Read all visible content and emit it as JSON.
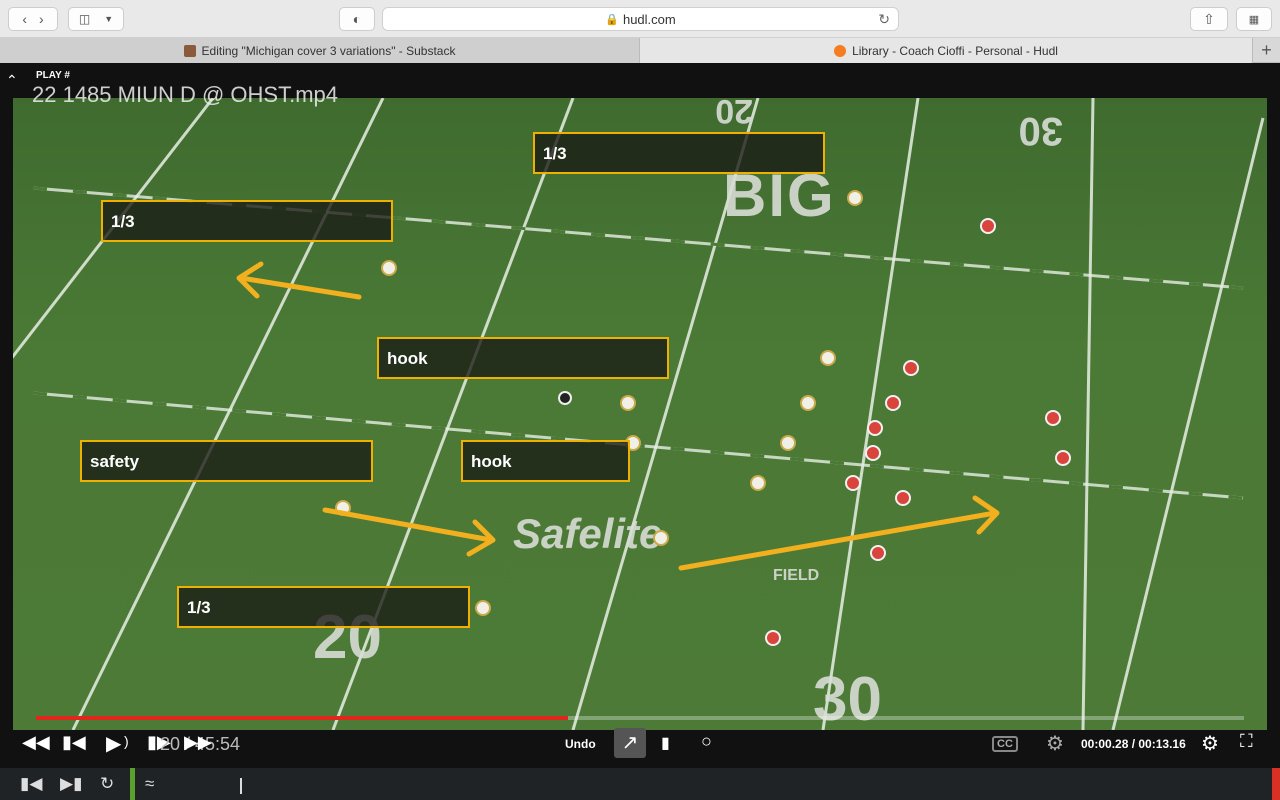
{
  "browser": {
    "url": "hudl.com",
    "tabs": [
      {
        "title": "Editing \"Michigan cover 3 variations\" - Substack"
      },
      {
        "title": "Library - Coach Cioffi - Personal - Hudl"
      }
    ],
    "new_tab_label": "+"
  },
  "player": {
    "play_label": "PLAY #",
    "filename": "22 1485 MIUN D @ OHST.mp4",
    "annotations": [
      {
        "text": "1/3"
      },
      {
        "text": "1/3"
      },
      {
        "text": "hook"
      },
      {
        "text": "safety"
      },
      {
        "text": "hook"
      },
      {
        "text": "1/3"
      }
    ],
    "field_numbers": [
      "20",
      "30",
      "30",
      "20"
    ],
    "field_logo": "BIG",
    "field_sponsor": "Safelite",
    "field_sponsor_sub": "FIELD",
    "progress": 0.44,
    "clip_time": "20 / 45:54",
    "undo_label": "Undo",
    "video_time": "00:00.28 / 00:13.16",
    "cc_label": "CC"
  },
  "colors": {
    "annotation_border": "#f0b000",
    "arrow": "#f2b01e",
    "progress": "#e1261c"
  }
}
